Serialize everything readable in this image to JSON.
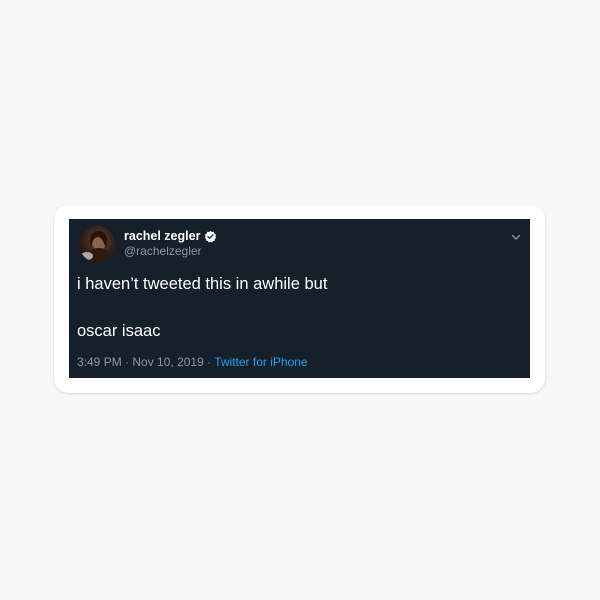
{
  "tweet": {
    "display_name": "rachel zegler",
    "handle": "@rachelzegler",
    "text_line1": "i haven’t tweeted this in awhile but",
    "text_line2": "oscar isaac",
    "time": "3:49 PM",
    "separator1": " · ",
    "date": "Nov 10, 2019",
    "separator2": " · ",
    "source": "Twitter for iPhone",
    "icons": {
      "verified": "verified-badge-icon",
      "menu": "chevron-down-icon",
      "avatar": "profile-avatar"
    }
  },
  "colors": {
    "page_background": "#f7f7f7",
    "sticker_border": "#ffffff",
    "tweet_background": "#15202b",
    "primary_text": "#ffffff",
    "secondary_text": "#8899a6",
    "link": "#1da1f2"
  }
}
